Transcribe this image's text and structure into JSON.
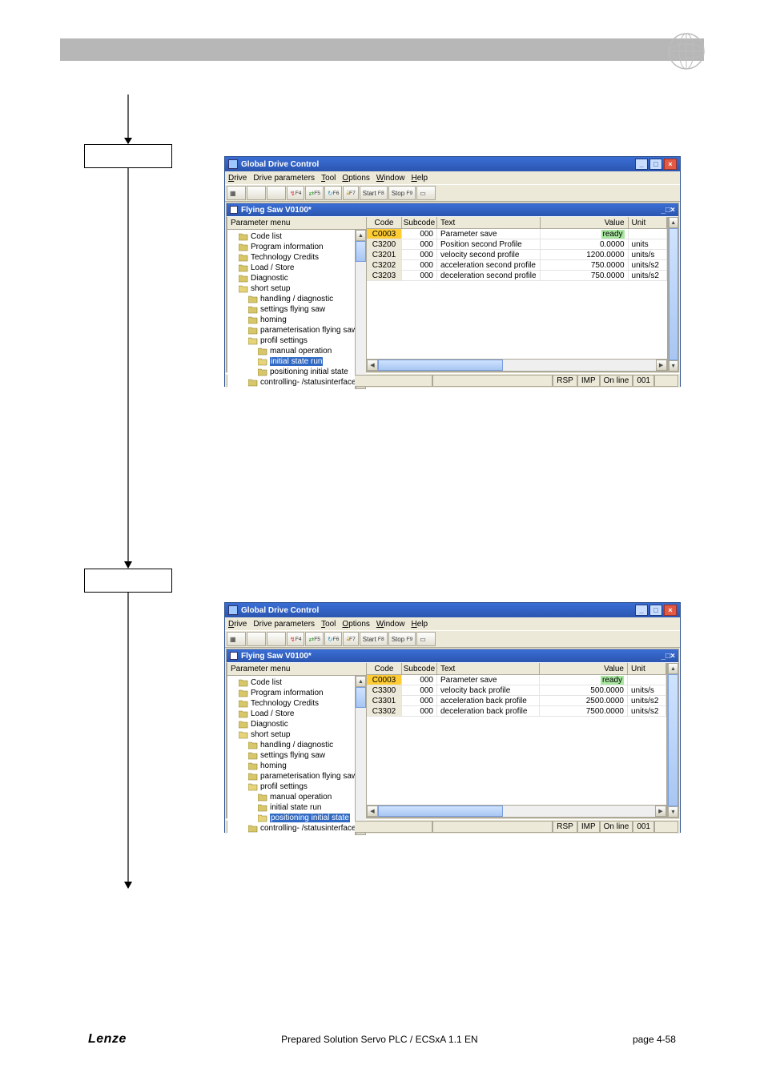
{
  "app_title": "Global Drive Control",
  "doc_title": "Flying Saw V0100*",
  "menu": {
    "drive": "Drive",
    "drive_params": "Drive parameters",
    "tool": "Tool",
    "options": "Options",
    "window": "Window",
    "help": "Help"
  },
  "toolbar": {
    "start": "Start",
    "start_key": "F8",
    "stop": "Stop",
    "stop_key": "F9",
    "f4": "F4",
    "f5": "F5",
    "f6": "F6",
    "f7": "F7"
  },
  "left_header": "Parameter menu",
  "grid_headers": {
    "code": "Code",
    "subcode": "Subcode",
    "text": "Text",
    "value": "Value",
    "unit": "Unit"
  },
  "tree_common": {
    "code_list": "Code list",
    "program_info": "Program information",
    "tech_credits": "Technology Credits",
    "load_store": "Load / Store",
    "diagnostic": "Diagnostic",
    "short_setup": "short setup",
    "handling_diag": "handling / diagnostic",
    "settings_flysaw": "settings flying saw",
    "homing": "homing",
    "param_flysaw": "parameterisation flying saw",
    "profil_settings": "profil settings",
    "manual_op": "manual operation",
    "initial_state": "initial state run",
    "pos_initial": "positioning initial state",
    "controlling": "controlling- /statusinterface"
  },
  "statusbar": {
    "rsp": "RSP",
    "imp": "IMP",
    "online": "On line",
    "addr": "001"
  },
  "screenshot1": {
    "status_left": "initial state run",
    "rows": [
      {
        "code": "C0003",
        "sub": "000",
        "text": "Parameter save",
        "value": "ready",
        "unit": "",
        "ready": true,
        "sel": true
      },
      {
        "code": "C3200",
        "sub": "000",
        "text": "Position second Profile",
        "value": "0.0000",
        "unit": "units"
      },
      {
        "code": "C3201",
        "sub": "000",
        "text": "velocity second profile",
        "value": "1200.0000",
        "unit": "units/s"
      },
      {
        "code": "C3202",
        "sub": "000",
        "text": "acceleration second profile",
        "value": "750.0000",
        "unit": "units/s2"
      },
      {
        "code": "C3203",
        "sub": "000",
        "text": "deceleration second profile",
        "value": "750.0000",
        "unit": "units/s2"
      }
    ]
  },
  "screenshot2": {
    "status_left": "positioning initial state",
    "rows": [
      {
        "code": "C0003",
        "sub": "000",
        "text": "Parameter save",
        "value": "ready",
        "unit": "",
        "ready": true,
        "sel": true
      },
      {
        "code": "C3300",
        "sub": "000",
        "text": "velocity back profile",
        "value": "500.0000",
        "unit": "units/s"
      },
      {
        "code": "C3301",
        "sub": "000",
        "text": "acceleration back profile",
        "value": "2500.0000",
        "unit": "units/s2"
      },
      {
        "code": "C3302",
        "sub": "000",
        "text": "deceleration back profile",
        "value": "7500.0000",
        "unit": "units/s2"
      }
    ]
  },
  "footer": {
    "brand": "Lenze",
    "center": "Prepared Solution Servo PLC / ECSxA 1.1 EN",
    "page": "page 4-58"
  }
}
